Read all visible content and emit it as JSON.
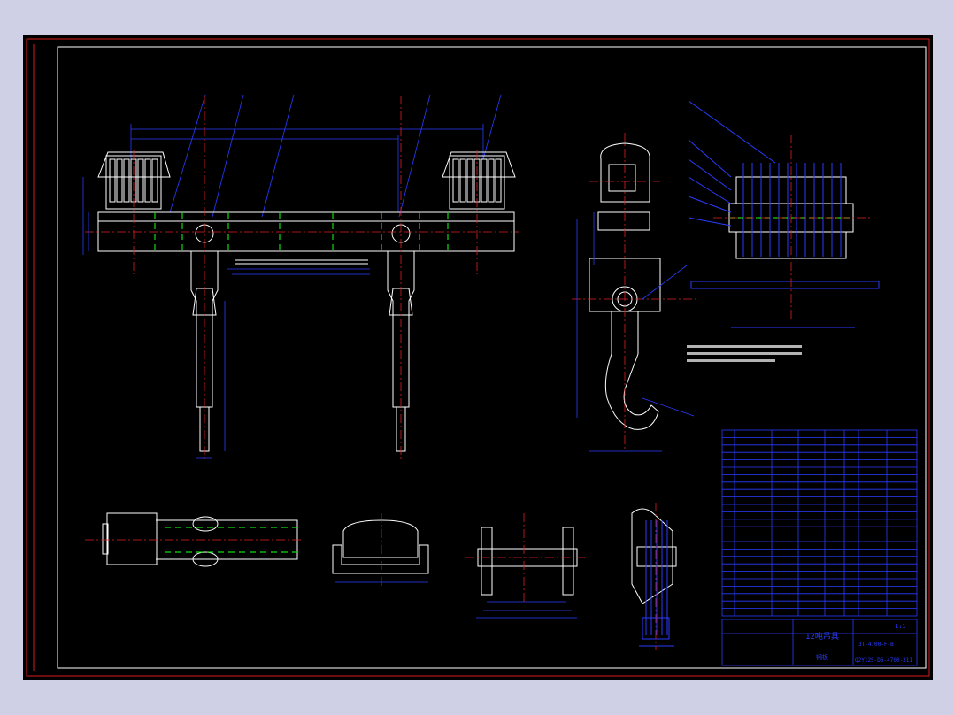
{
  "drawing": {
    "title_block": {
      "product_name": "12吨吊具",
      "material_label": "钢板",
      "scale": "1:1",
      "drawing_number": "Q2Y125-D6-4700-311",
      "sub_number": "3T-4700-F-B"
    },
    "colors": {
      "frame": "#d81c1c",
      "border": "#ffffff",
      "outline": "#ffffff",
      "center": "#e02020",
      "dimension": "#2a3cff",
      "hidden": "#14d814",
      "sheet_bg": "#000000",
      "window_bg": "#cfd0e6"
    },
    "bom_row_count": 24
  }
}
